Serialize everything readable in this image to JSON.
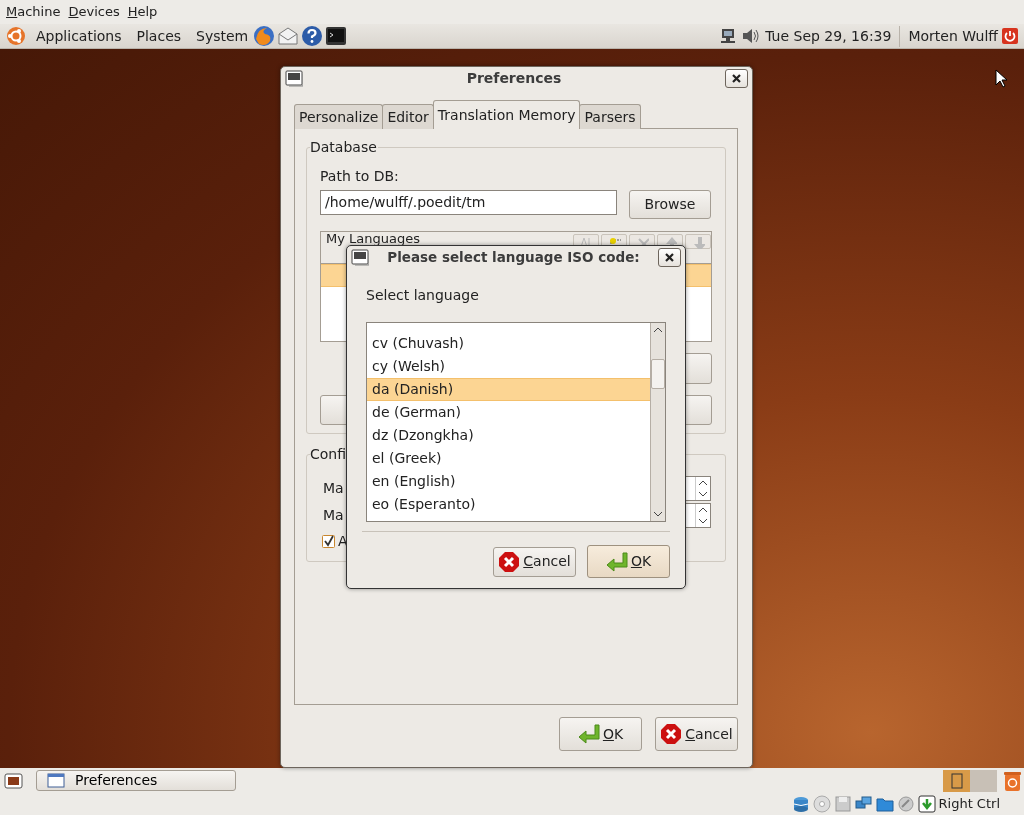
{
  "vm_menu": [
    {
      "label": "Machine",
      "mnemonic": true
    },
    {
      "label": "Devices",
      "mnemonic": true
    },
    {
      "label": "Help",
      "mnemonic": true
    }
  ],
  "top_panel": {
    "menus": [
      "Applications",
      "Places",
      "System"
    ],
    "clock": "Tue Sep 29, 16:39",
    "user": "Morten Wulff"
  },
  "preferences": {
    "title": "Preferences",
    "tabs": [
      {
        "label": "Personalize",
        "selected": false
      },
      {
        "label": "Editor",
        "selected": false
      },
      {
        "label": "Translation Memory",
        "selected": true
      },
      {
        "label": "Parsers",
        "selected": false
      }
    ],
    "database": {
      "legend": "Database",
      "path_label": "Path to DB:",
      "path_value": "/home/wulff/.poedit/tm",
      "browse": "Browse",
      "languages_header": "My Languages",
      "rows": [
        {
          "selected": true
        }
      ]
    },
    "config": {
      "legend": "Confi",
      "rows": [
        {
          "kind": "spin",
          "label": "Ma"
        },
        {
          "kind": "spin",
          "label": "Ma"
        },
        {
          "kind": "check",
          "label": "A",
          "checked": true
        }
      ]
    },
    "buttons": [
      {
        "kind": "ok",
        "label": "OK",
        "mnemonic": true,
        "default": false
      },
      {
        "kind": "cancel",
        "label": "Cancel",
        "mnemonic": true,
        "default": false
      }
    ]
  },
  "language_dialog": {
    "title": "Please select language ISO code:",
    "prompt": "Select language",
    "languages": [
      {
        "label": "cv (Chuvash)",
        "selected": false
      },
      {
        "label": "cy (Welsh)",
        "selected": false
      },
      {
        "label": "da (Danish)",
        "selected": true
      },
      {
        "label": "de (German)",
        "selected": false
      },
      {
        "label": "dz (Dzongkha)",
        "selected": false
      },
      {
        "label": "el (Greek)",
        "selected": false
      },
      {
        "label": "en (English)",
        "selected": false
      },
      {
        "label": "eo (Esperanto)",
        "selected": false
      }
    ],
    "buttons": [
      {
        "kind": "cancel",
        "label": "Cancel",
        "mnemonic": true,
        "default": false
      },
      {
        "kind": "ok",
        "label": "OK",
        "mnemonic": true,
        "default": true
      }
    ]
  },
  "taskbar": {
    "tasks": [
      {
        "label": "Preferences"
      }
    ]
  },
  "status_bar": {
    "host_key": "Right Ctrl"
  }
}
